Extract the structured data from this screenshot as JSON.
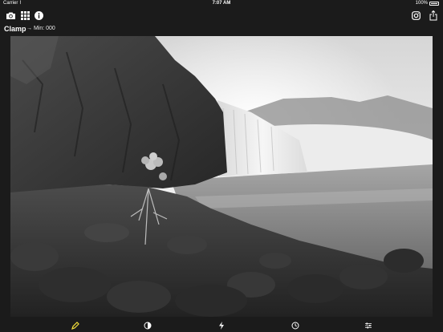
{
  "status_bar": {
    "carrier": "Carrier ⌇",
    "time": "7:07 AM",
    "battery": "100%"
  },
  "toolbar": {
    "left_icons": [
      "camera-icon",
      "grid-icon",
      "info-icon"
    ],
    "right_icons": [
      "instagram-icon",
      "share-icon"
    ]
  },
  "filter": {
    "name": "Clamp",
    "value_label": "→ Min: 000"
  },
  "bottom_bar": {
    "icons": [
      "pencil-icon",
      "contrast-icon",
      "flash-icon",
      "timer-icon",
      "sliders-icon"
    ],
    "active_icon": "pencil-icon",
    "active_color": "#f5e03b"
  },
  "colors": {
    "background": "#1b1b1b",
    "accent": "#f5e03b"
  }
}
